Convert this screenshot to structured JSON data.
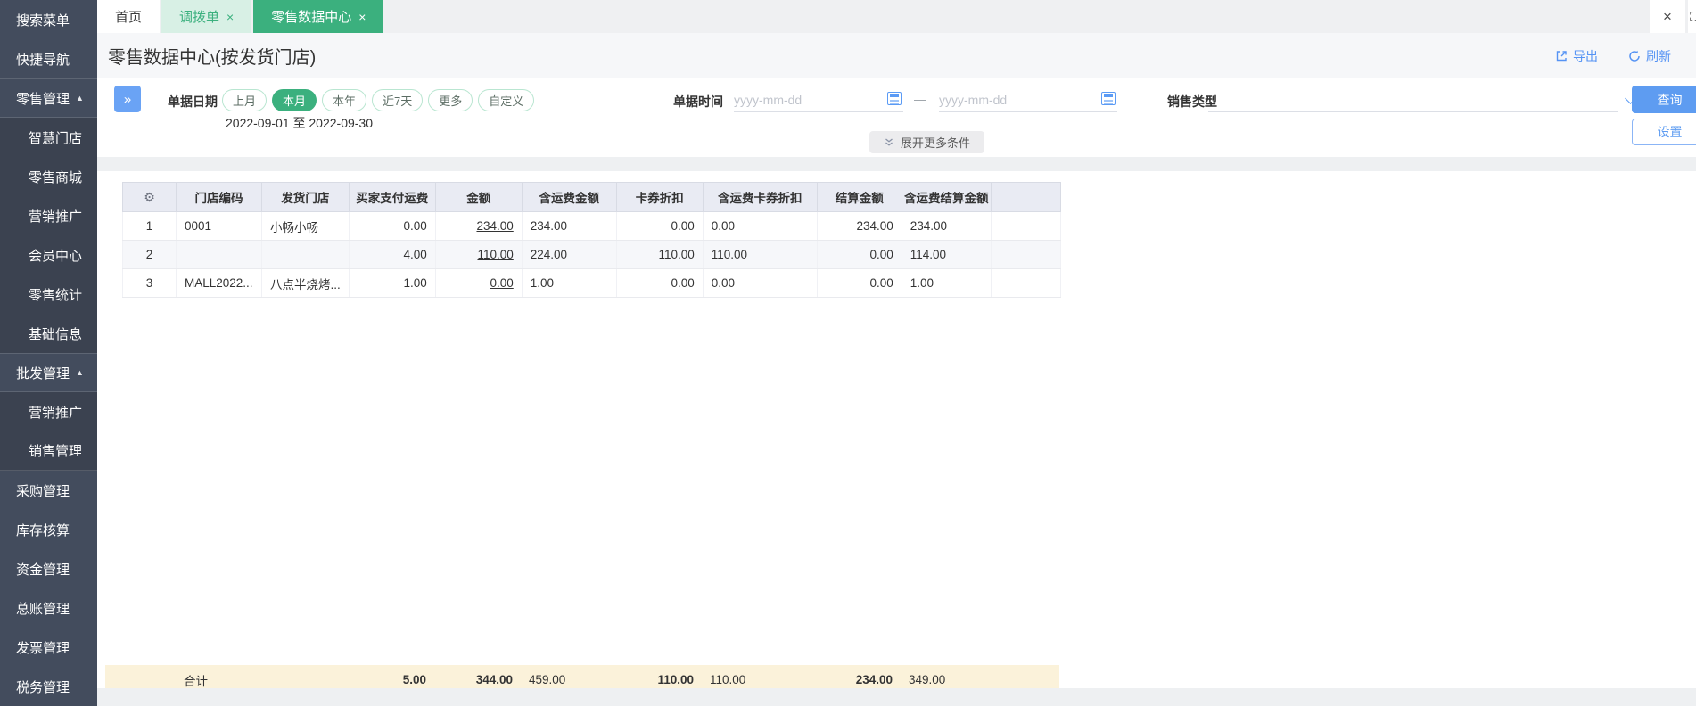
{
  "sidebar": {
    "items": [
      {
        "label": "搜索菜单"
      },
      {
        "label": "快捷导航"
      },
      {
        "label": "零售管理"
      },
      {
        "label": "智慧门店"
      },
      {
        "label": "零售商城"
      },
      {
        "label": "营销推广"
      },
      {
        "label": "会员中心"
      },
      {
        "label": "零售统计"
      },
      {
        "label": "基础信息"
      },
      {
        "label": "批发管理"
      },
      {
        "label": "营销推广"
      },
      {
        "label": "销售管理"
      },
      {
        "label": "采购管理"
      },
      {
        "label": "库存核算"
      },
      {
        "label": "资金管理"
      },
      {
        "label": "总账管理"
      },
      {
        "label": "发票管理"
      },
      {
        "label": "税务管理"
      }
    ]
  },
  "tabs": {
    "home": "首页",
    "transfer": "调拨单",
    "retail_data": "零售数据中心",
    "close_glyph": "×"
  },
  "window_controls": {
    "close": "×",
    "fullscreen": "⛶"
  },
  "page": {
    "title": "零售数据中心(按发货门店)",
    "export_label": "导出",
    "refresh_label": "刷新"
  },
  "filters": {
    "date_label": "单据日期",
    "date_pills": [
      "上月",
      "本月",
      "本年",
      "近7天",
      "更多",
      "自定义"
    ],
    "selected_pill": "本月",
    "date_range": "2022-09-01 至 2022-09-30",
    "time_label": "单据时间",
    "time_placeholder": "yyyy-mm-dd",
    "range_separator": "—",
    "sales_type_label": "销售类型",
    "sales_type_value": "",
    "query_button": "查询",
    "settings_button": "设置",
    "expand_more": "展开更多条件"
  },
  "icons": {
    "collapse": "»",
    "caret_up": "▲",
    "gear": "⚙"
  },
  "colors": {
    "sidebar_bg": "#414a5a",
    "tab_active_green": "#3bb07e",
    "tab_mint": "#d8f0e5",
    "link_blue": "#5593f4",
    "primary_button": "#5e9cf1",
    "table_header_bg": "#e9ebf3",
    "total_row_bg": "#fbf2da"
  },
  "table": {
    "columns": [
      "门店编码",
      "发货门店",
      "买家支付运费",
      "金额",
      "含运费金额",
      "卡券折扣",
      "含运费卡券折扣",
      "结算金额",
      "含运费结算金额"
    ],
    "rows": [
      {
        "seq": "1",
        "store_code": "0001",
        "store_name": "小畅小畅",
        "buyer_shipping": "0.00",
        "amount": "234.00",
        "amount_incl_shipping": "234.00",
        "coupon_discount": "0.00",
        "coupon_discount_incl_shipping": "0.00",
        "settle_amount": "234.00",
        "settle_incl_shipping": "234.00"
      },
      {
        "seq": "2",
        "store_code": "",
        "store_name": "",
        "buyer_shipping": "4.00",
        "amount": "110.00",
        "amount_incl_shipping": "224.00",
        "coupon_discount": "110.00",
        "coupon_discount_incl_shipping": "110.00",
        "settle_amount": "0.00",
        "settle_incl_shipping": "114.00"
      },
      {
        "seq": "3",
        "store_code": "MALL2022...",
        "store_name": "八点半烧烤...",
        "buyer_shipping": "1.00",
        "amount": "0.00",
        "amount_incl_shipping": "1.00",
        "coupon_discount": "0.00",
        "coupon_discount_incl_shipping": "0.00",
        "settle_amount": "0.00",
        "settle_incl_shipping": "1.00"
      }
    ],
    "footer": {
      "label": "合计",
      "buyer_shipping": "5.00",
      "amount": "344.00",
      "amount_incl_shipping": "459.00",
      "coupon_discount": "110.00",
      "coupon_discount_incl_shipping": "110.00",
      "settle_amount": "234.00",
      "settle_incl_shipping": "349.00"
    }
  }
}
